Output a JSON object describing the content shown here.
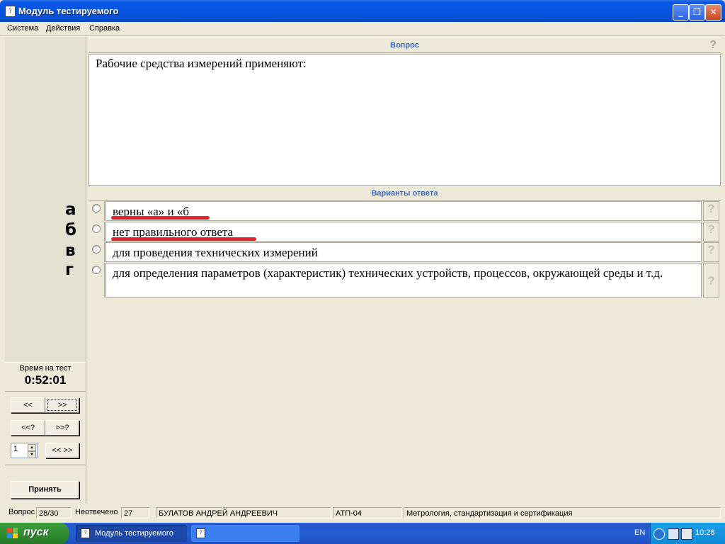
{
  "window": {
    "title": "Модуль тестируемого",
    "icon_label": "?",
    "controls": {
      "minimize": "_",
      "maximize": "❐",
      "close": "✕"
    }
  },
  "menu": [
    "Система",
    "Действия",
    "Справка"
  ],
  "question_header": "Вопрос",
  "question_help": "?",
  "question_text": "Рабочие средства измерений применяют:",
  "answers_header": "Варианты ответа",
  "answers": [
    {
      "letter": "а",
      "text": "верны «а» и «б",
      "help": "?",
      "underlined": true
    },
    {
      "letter": "б",
      "text": "нет правильного ответа",
      "help": "?",
      "underlined": true
    },
    {
      "letter": "в",
      "text": "для проведения технических измерений",
      "help": "?",
      "underlined": false
    },
    {
      "letter": "г",
      "text": "для определения параметров (характеристик) технических устройств, процессов, окружающей среды и т.д.",
      "help": "?",
      "underlined": false
    }
  ],
  "timer": {
    "label": "Время на тест",
    "value": "0:52:01"
  },
  "nav": {
    "prev": "<<",
    "next": ">>",
    "prev_unanswered": "<<?",
    "next_unanswered": ">>?",
    "goto_value": "1",
    "goto": "<< >>",
    "accept": "Принять"
  },
  "status": {
    "question_label": "Вопрос",
    "question_value": "28/30",
    "unanswered_label": "Неотвечено",
    "unanswered_value": "27",
    "student": "БУЛАТОВ АНДРЕЙ АНДРЕЕВИЧ",
    "group": "АТП-04",
    "subject": "Метрология, стандартизация и сертификация"
  },
  "taskbar": {
    "start": "пуск",
    "task_active": "Модуль тестируемого",
    "task_icon_label": "?",
    "language": "EN",
    "clock": "10:28"
  },
  "colors": {
    "accent_blue": "#3a6cc8",
    "underline_red": "#e0262c",
    "title_bar": "#0654e0",
    "start_green": "#2f8a2f"
  }
}
